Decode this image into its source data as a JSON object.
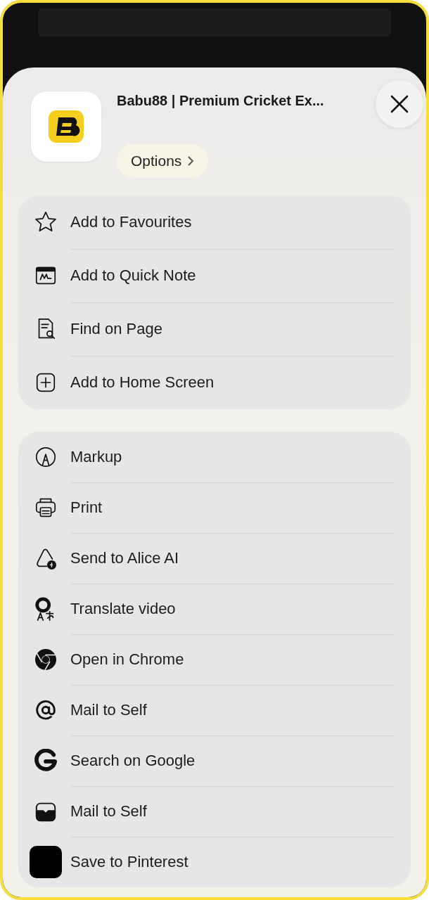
{
  "header": {
    "title": "Babu88 | Premium Cricket Ex...",
    "options": "Options"
  },
  "groups": [
    {
      "items": [
        {
          "kind": "star",
          "label": "Add to Favourites"
        },
        {
          "kind": "note",
          "label": "Add to Quick Note"
        },
        {
          "kind": "find",
          "label": "Find on Page"
        },
        {
          "kind": "plus",
          "label": "Add to Home Screen"
        }
      ]
    },
    {
      "items": [
        {
          "kind": "markup",
          "label": "Markup"
        },
        {
          "kind": "print",
          "label": "Print"
        },
        {
          "kind": "alice",
          "label": "Send to Alice AI"
        },
        {
          "kind": "translate",
          "label": "Translate video"
        },
        {
          "kind": "chrome",
          "label": "Open in Chrome"
        },
        {
          "kind": "at",
          "label": "Mail to Self"
        },
        {
          "kind": "google",
          "label": "Search on Google"
        },
        {
          "kind": "tray",
          "label": "Mail to Self"
        },
        {
          "kind": "square",
          "label": "Save to Pinterest"
        }
      ]
    }
  ]
}
